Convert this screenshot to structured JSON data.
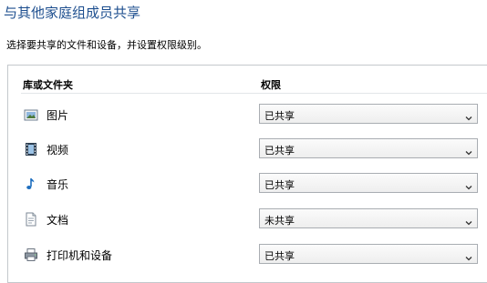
{
  "page": {
    "title": "与其他家庭组成员共享",
    "subtitle": "选择要共享的文件和设备，并设置权限级别。"
  },
  "table": {
    "col_name": "库或文件夹",
    "col_permission": "权限",
    "rows": [
      {
        "label": "图片",
        "permission": "已共享",
        "icon": "pictures-icon"
      },
      {
        "label": "视频",
        "permission": "已共享",
        "icon": "videos-icon"
      },
      {
        "label": "音乐",
        "permission": "已共享",
        "icon": "music-icon"
      },
      {
        "label": "文档",
        "permission": "未共享",
        "icon": "documents-icon"
      },
      {
        "label": "打印机和设备",
        "permission": "已共享",
        "icon": "printer-icon"
      }
    ]
  },
  "colors": {
    "title": "#1e4f8f",
    "border": "#c4c8cc",
    "select_border": "#a9adb2"
  }
}
